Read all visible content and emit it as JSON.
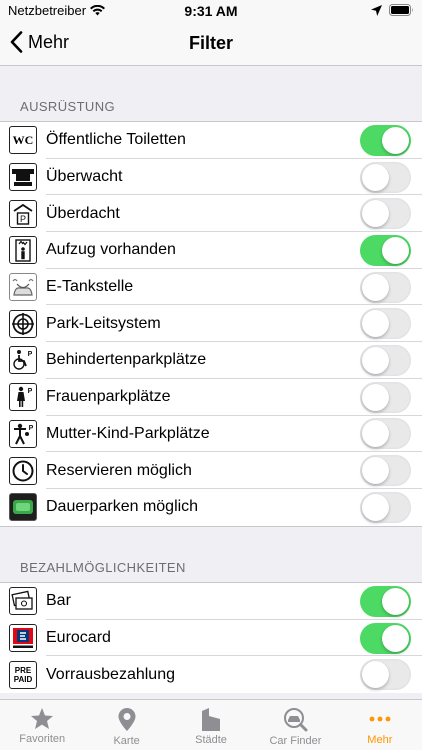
{
  "status_bar": {
    "carrier": "Netzbetreiber",
    "time": "9:31 AM"
  },
  "nav": {
    "back_label": "Mehr",
    "title": "Filter"
  },
  "colors": {
    "switch_on": "#4cd964",
    "accent": "#ff9500"
  },
  "sections": [
    {
      "header": "AUSRÜSTUNG",
      "items": [
        {
          "label": "Öffentliche Toiletten",
          "icon": "wc-icon",
          "icon_text": "WC",
          "on": true
        },
        {
          "label": "Überwacht",
          "icon": "camera-icon",
          "on": false
        },
        {
          "label": "Überdacht",
          "icon": "covered-parking-icon",
          "icon_text": "P",
          "on": false
        },
        {
          "label": "Aufzug vorhanden",
          "icon": "elevator-icon",
          "on": true
        },
        {
          "label": "E-Tankstelle",
          "icon": "ev-charging-icon",
          "on": false
        },
        {
          "label": "Park-Leitsystem",
          "icon": "guidance-system-icon",
          "on": false
        },
        {
          "label": "Behindertenparkplätze",
          "icon": "wheelchair-parking-icon",
          "icon_text": "P",
          "on": false
        },
        {
          "label": "Frauenparkplätze",
          "icon": "women-parking-icon",
          "icon_text": "P",
          "on": false
        },
        {
          "label": "Mutter-Kind-Parkplätze",
          "icon": "family-parking-icon",
          "icon_text": "P",
          "on": false
        },
        {
          "label": "Reservieren möglich",
          "icon": "clock-icon",
          "on": false
        },
        {
          "label": "Dauerparken möglich",
          "icon": "long-term-parking-icon",
          "on": false
        }
      ]
    },
    {
      "header": "BEZAHLMÖGLICHKEITEN",
      "items": [
        {
          "label": "Bar",
          "icon": "cash-icon",
          "on": true
        },
        {
          "label": "Eurocard",
          "icon": "eurocard-icon",
          "on": true
        },
        {
          "label": "Vorrausbezahlung",
          "icon": "prepaid-icon",
          "icon_text": "PRE PAID",
          "on": false
        }
      ]
    }
  ],
  "tabbar": [
    {
      "label": "Favoriten",
      "icon": "star-icon",
      "active": false
    },
    {
      "label": "Karte",
      "icon": "map-pin-icon",
      "active": false
    },
    {
      "label": "Städte",
      "icon": "city-icon",
      "active": false
    },
    {
      "label": "Car Finder",
      "icon": "car-finder-icon",
      "active": false
    },
    {
      "label": "Mehr",
      "icon": "more-icon",
      "active": true
    }
  ]
}
